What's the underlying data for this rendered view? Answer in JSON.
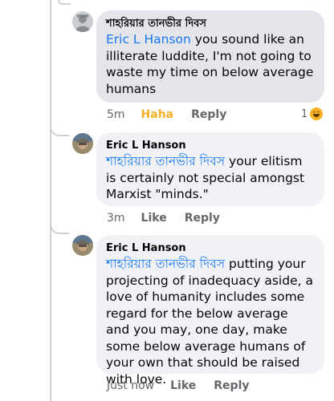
{
  "comments": [
    {
      "author": "শাহরিয়ার তানভীর দিবস",
      "mention": "Eric L Hanson",
      "body": " you sound like an illiterate luddite, I'm not going to waste my time on below average humans",
      "time": "5m",
      "reaction_label": "Haha",
      "reply_label": "Reply",
      "reaction_count": "1",
      "reaction_icon": "haha-emoji-icon"
    },
    {
      "author": "Eric L Hanson",
      "mention": "শাহরিয়ার তানভীর দিবস",
      "body": " your elitism is certainly not special amongst Marxist \"minds.\"",
      "time": "3m",
      "like_label": "Like",
      "reply_label": "Reply"
    },
    {
      "author": "Eric L Hanson",
      "mention": "শাহরিয়ার তানভীর দিবস",
      "body": " putting your projecting of inadequacy aside, a love of humanity includes some regard for the below average and you may, one day, make some below average humans of your own that should be raised with love.",
      "time": "Just now",
      "like_label": "Like",
      "reply_label": "Reply"
    }
  ],
  "colors": {
    "mention": "#1877f2",
    "haha": "#f7b125",
    "meta": "#65676b",
    "bubble_selected": "#e4e6eb",
    "bubble": "#f0f2f5"
  }
}
